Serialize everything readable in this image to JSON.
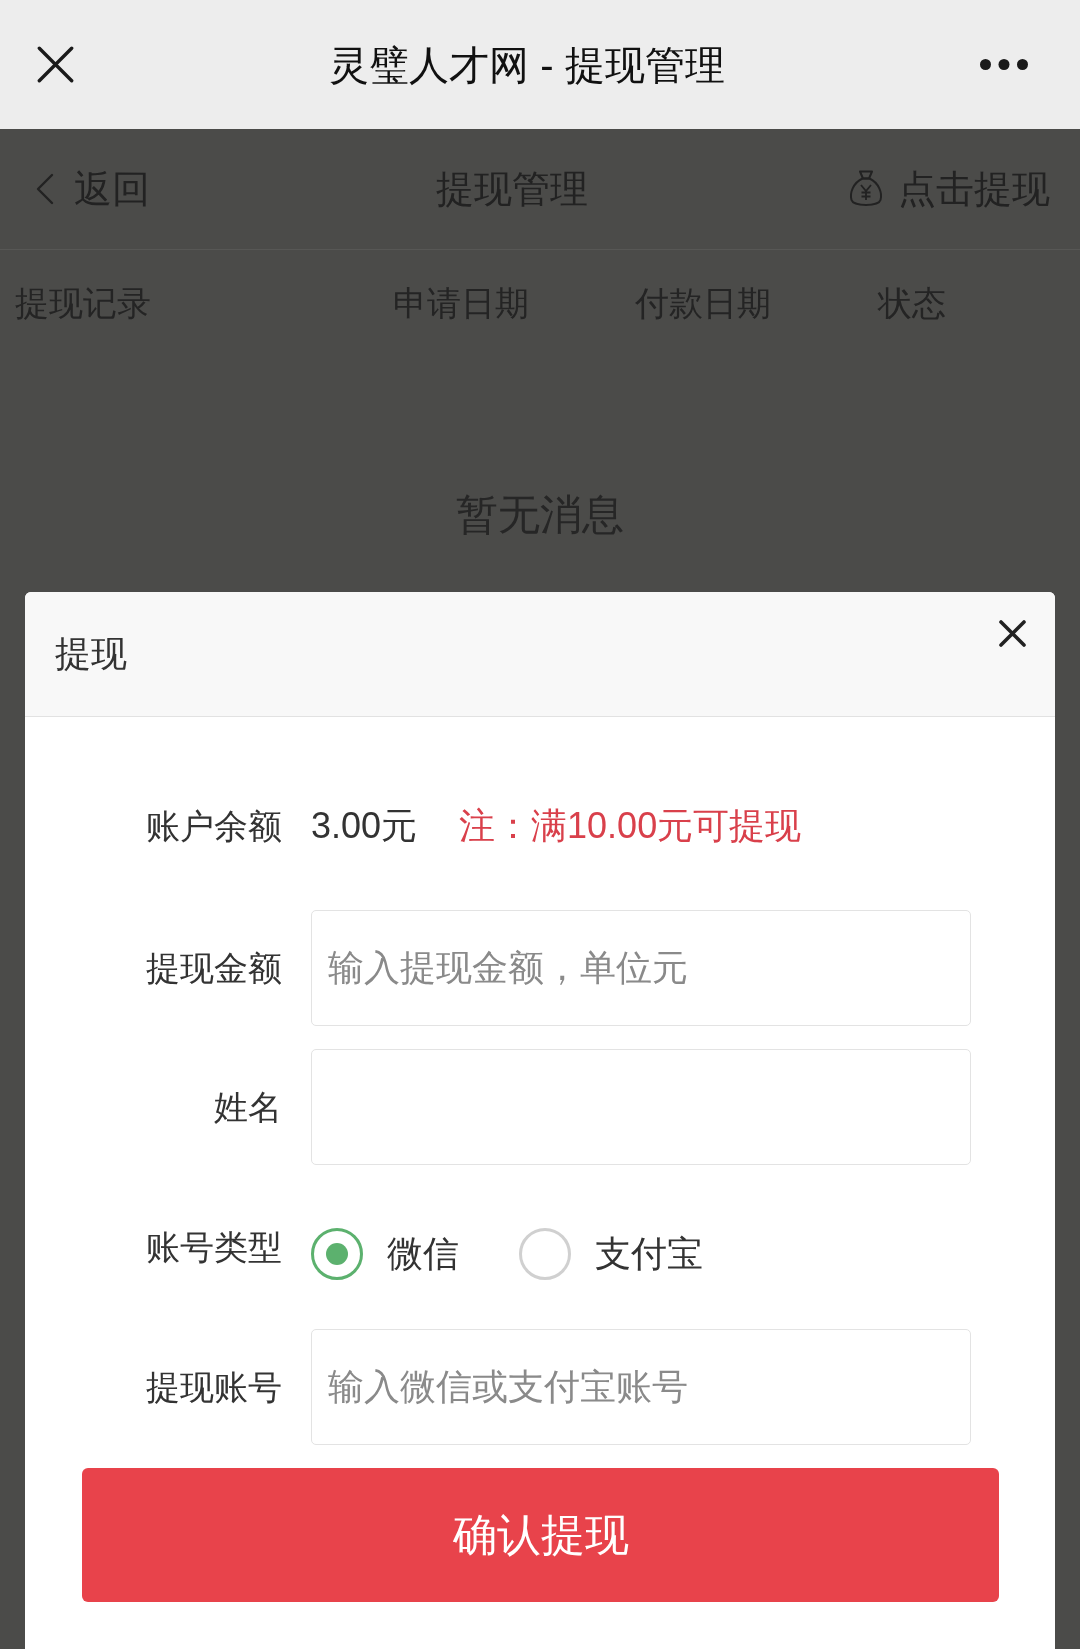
{
  "window": {
    "title": "灵璧人才网 - 提现管理"
  },
  "page": {
    "back": "返回",
    "title": "提现管理",
    "action": "点击提现",
    "columns": [
      "提现记录",
      "申请日期",
      "付款日期",
      "状态"
    ],
    "empty_message": "暂无消息"
  },
  "dialog": {
    "title": "提现",
    "fields": [
      {
        "kind": "balance",
        "label": "账户余额",
        "value": "3.00元",
        "note": "注：满10.00元可提现"
      },
      {
        "kind": "input",
        "label": "提现金额",
        "placeholder": "输入提现金额，单位元"
      },
      {
        "kind": "input",
        "label": "姓名"
      },
      {
        "kind": "radio",
        "label": "账号类型",
        "options": [
          {
            "label": "微信",
            "selected": true
          },
          {
            "label": "支付宝",
            "selected": false
          }
        ]
      },
      {
        "kind": "input",
        "label": "提现账号",
        "placeholder": "输入微信或支付宝账号"
      }
    ],
    "submit": "确认提现"
  }
}
